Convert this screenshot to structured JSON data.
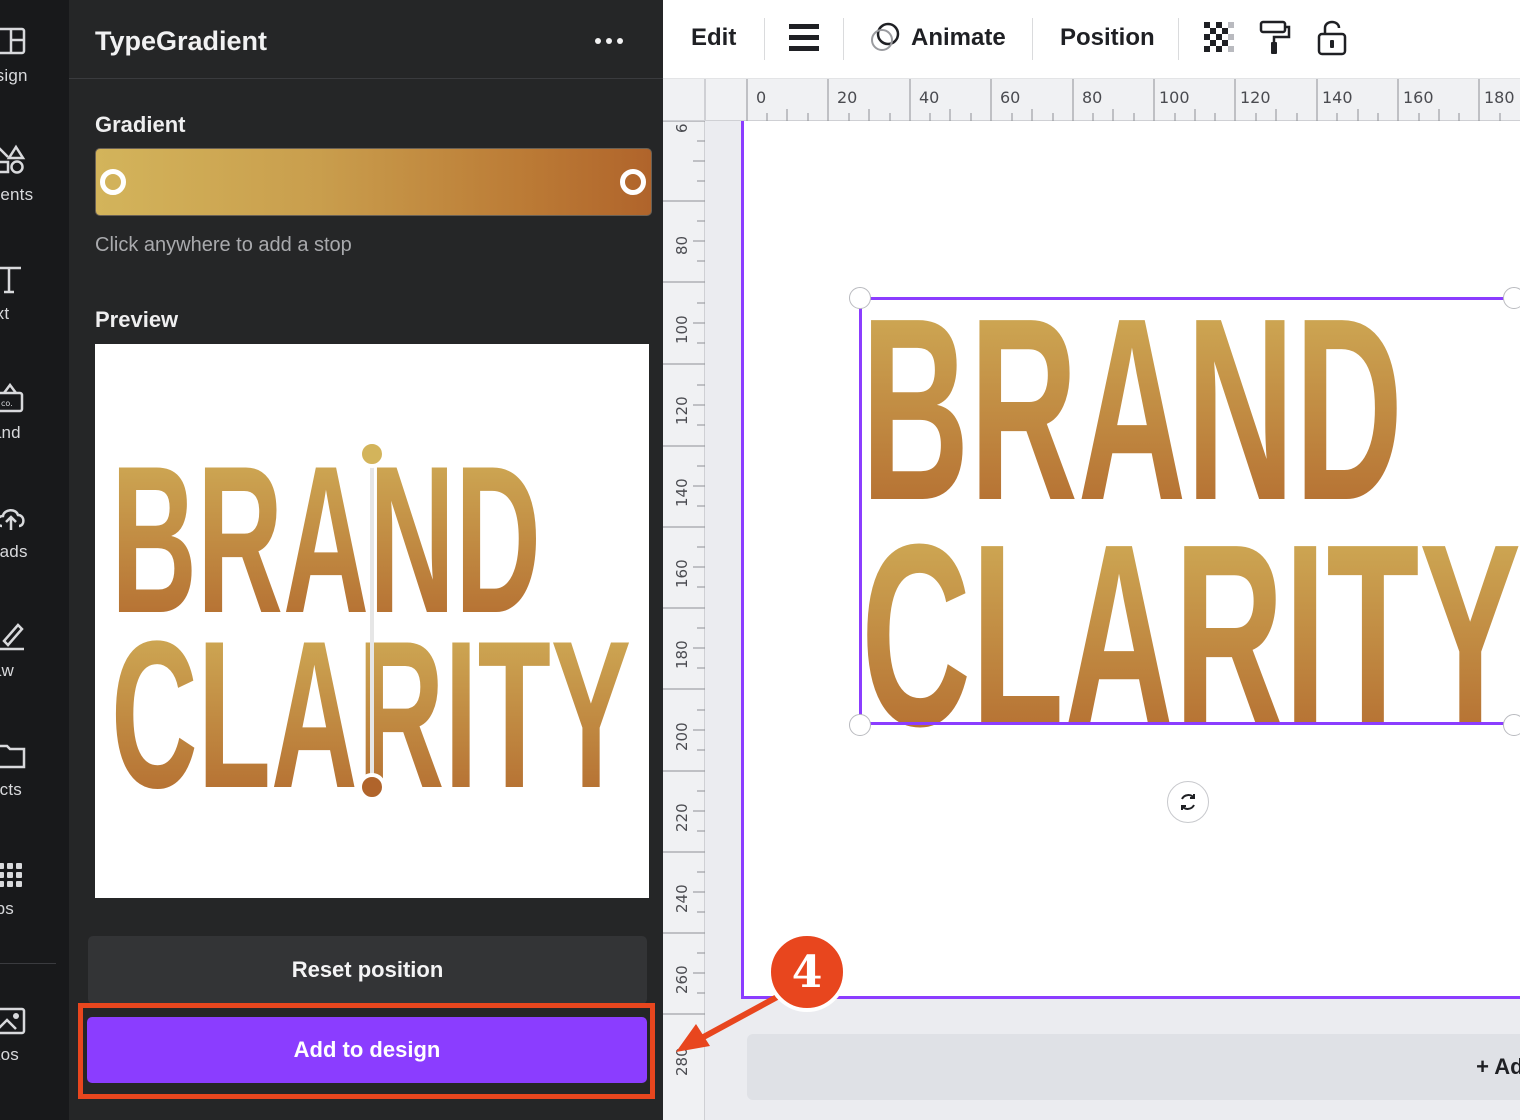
{
  "rail": {
    "items": [
      {
        "label": "esign",
        "icon": "layout-icon"
      },
      {
        "label": "ments",
        "icon": "shapes-icon"
      },
      {
        "label": "ext",
        "icon": "text-icon"
      },
      {
        "label": "rand",
        "icon": "brand-icon"
      },
      {
        "label": "loads",
        "icon": "upload-icon"
      },
      {
        "label": "raw",
        "icon": "draw-icon"
      },
      {
        "label": "jects",
        "icon": "folder-icon"
      },
      {
        "label": "pps",
        "icon": "apps-icon"
      },
      {
        "label": "otos",
        "icon": "image-icon"
      }
    ]
  },
  "panel": {
    "title": "TypeGradient",
    "gradient_label": "Gradient",
    "gradient_hint": "Click anywhere to add a stop",
    "gradient_colors": {
      "start": "#d3b45b",
      "end": "#b0642b"
    },
    "preview_label": "Preview",
    "preview_text": {
      "line1": "BRAND",
      "line2": "CLARITY"
    },
    "reset_label": "Reset position",
    "add_label": "Add to design"
  },
  "toolbar": {
    "edit_label": "Edit",
    "animate_label": "Animate",
    "position_label": "Position"
  },
  "ruler": {
    "top_ticks": [
      "0",
      "20",
      "40",
      "60",
      "80",
      "100",
      "120",
      "140",
      "160",
      "180"
    ],
    "left_ticks": [
      "6",
      "80",
      "100",
      "120",
      "140",
      "160",
      "180",
      "200",
      "220",
      "240",
      "260",
      "280"
    ]
  },
  "canvas": {
    "text": {
      "line1": "BRAND",
      "line2": "CLARITY"
    },
    "add_page_label": "+ Add"
  },
  "annotation": {
    "step": "4"
  },
  "colors": {
    "accent": "#8b3dff",
    "annotation": "#e8461e"
  }
}
